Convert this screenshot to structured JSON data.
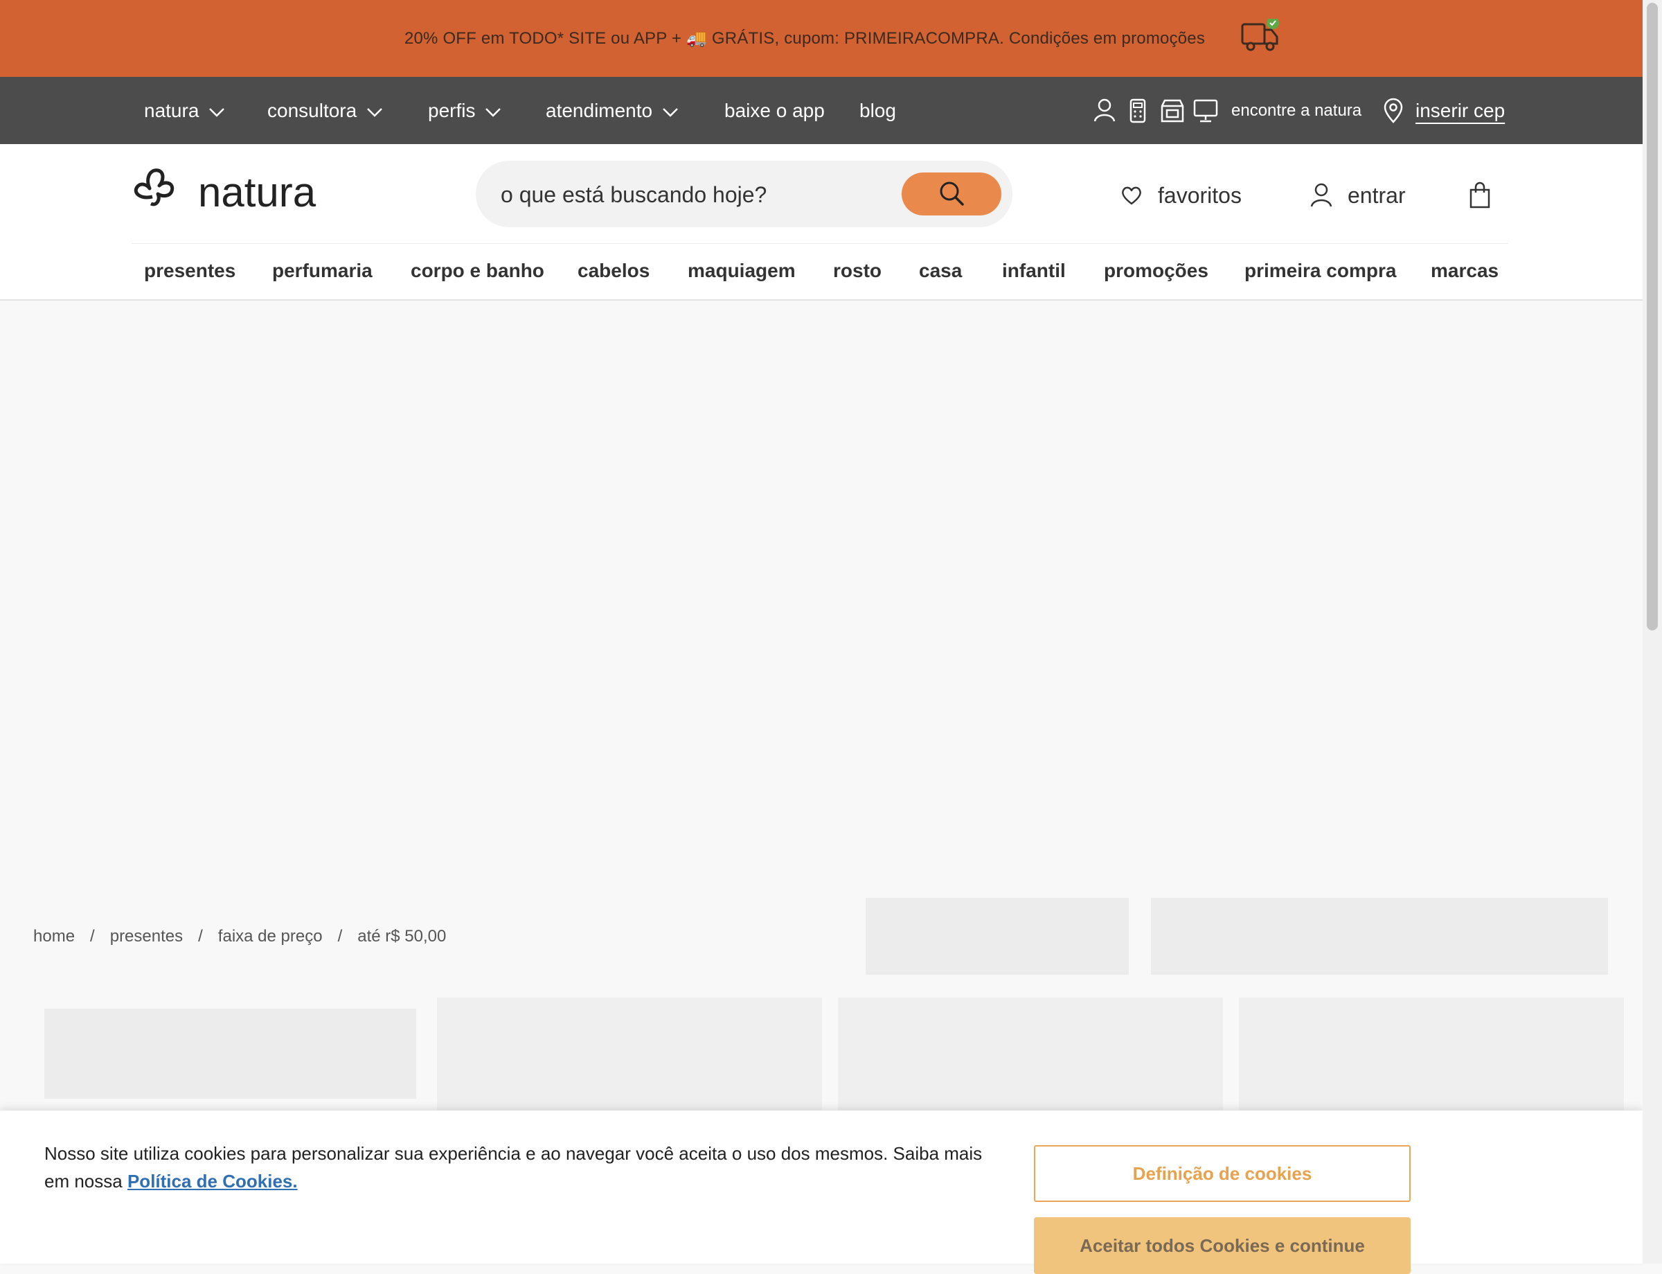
{
  "promo": {
    "text": "20% OFF em TODO* SITE ou APP + 🚚 GRÁTIS, cupom: PRIMEIRACOMPRA. Condições em promoções",
    "icon": "delivery-truck-check-icon",
    "color": "#d36232"
  },
  "topnav": {
    "items": [
      {
        "label": "natura",
        "dropdown": true
      },
      {
        "label": "consultora",
        "dropdown": true
      },
      {
        "label": "perfis",
        "dropdown": true
      },
      {
        "label": "atendimento",
        "dropdown": true
      },
      {
        "label": "baixe o app",
        "dropdown": false
      },
      {
        "label": "blog",
        "dropdown": false
      }
    ],
    "find_label": "encontre a natura",
    "cep_label": "inserir cep",
    "color": "#4c4c4c"
  },
  "header": {
    "logo_text": "natura",
    "search_placeholder": "o que está buscando hoje?",
    "favorites_label": "favoritos",
    "login_label": "entrar",
    "accent": "#e98a4c"
  },
  "categories": [
    "presentes",
    "perfumaria",
    "corpo e banho",
    "cabelos",
    "maquiagem",
    "rosto",
    "casa",
    "infantil",
    "promoções",
    "primeira compra",
    "marcas"
  ],
  "breadcrumb": [
    "home",
    "presentes",
    "faixa de preço",
    "até r$ 50,00"
  ],
  "breadcrumb_separator": "/",
  "cookie": {
    "text": "Nosso site utiliza cookies para personalizar sua experiência e ao navegar você aceita o uso dos mesmos. Saiba mais em nossa",
    "link": "Política de Cookies.",
    "settings_button": "Definição de cookies",
    "accept_button": "Aceitar todos Cookies e continue"
  }
}
